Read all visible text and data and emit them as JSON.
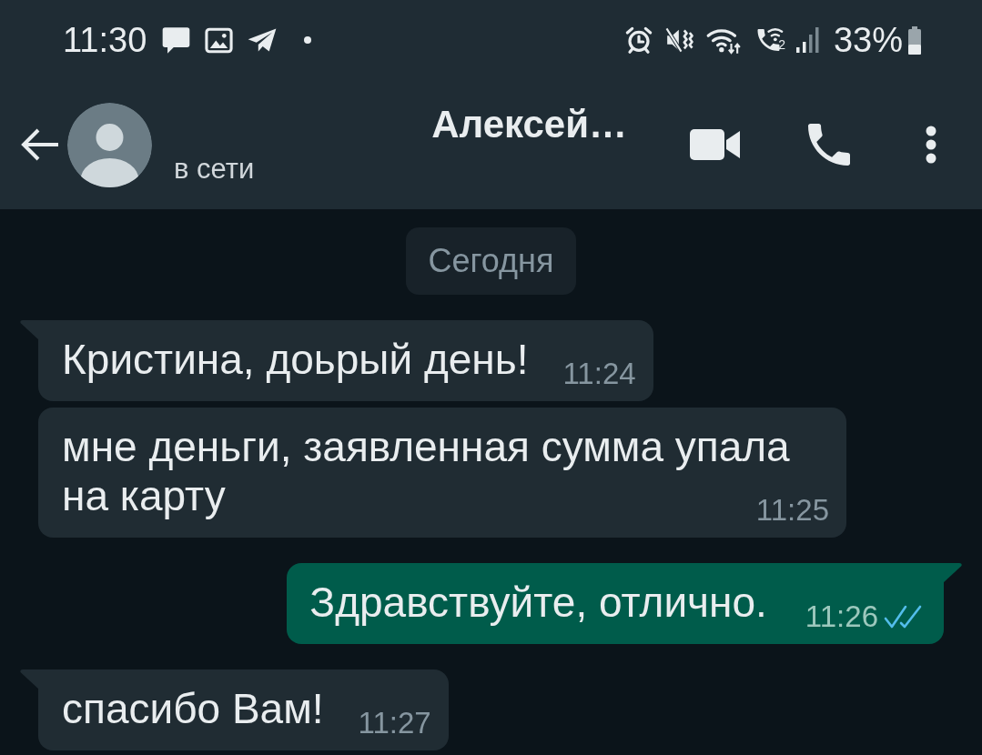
{
  "status_bar": {
    "time": "11:30",
    "sim_slot": "2",
    "battery": "33%"
  },
  "header": {
    "title": "Алексей…",
    "presence": "в сети"
  },
  "date_chip": "Сегодня",
  "messages": [
    {
      "outgoing": false,
      "text": "Кристина, доьрый день!",
      "time": "11:24",
      "tail": true
    },
    {
      "outgoing": false,
      "text": "мне деньги, заявленная сумма упала на карту",
      "time": "11:25",
      "tail": false
    },
    {
      "outgoing": true,
      "text": "Здравствуйте, отлично.",
      "time": "11:26",
      "tail": true,
      "read": true
    },
    {
      "outgoing": false,
      "text": "спасибо Вам!",
      "time": "11:27",
      "tail": true
    }
  ]
}
